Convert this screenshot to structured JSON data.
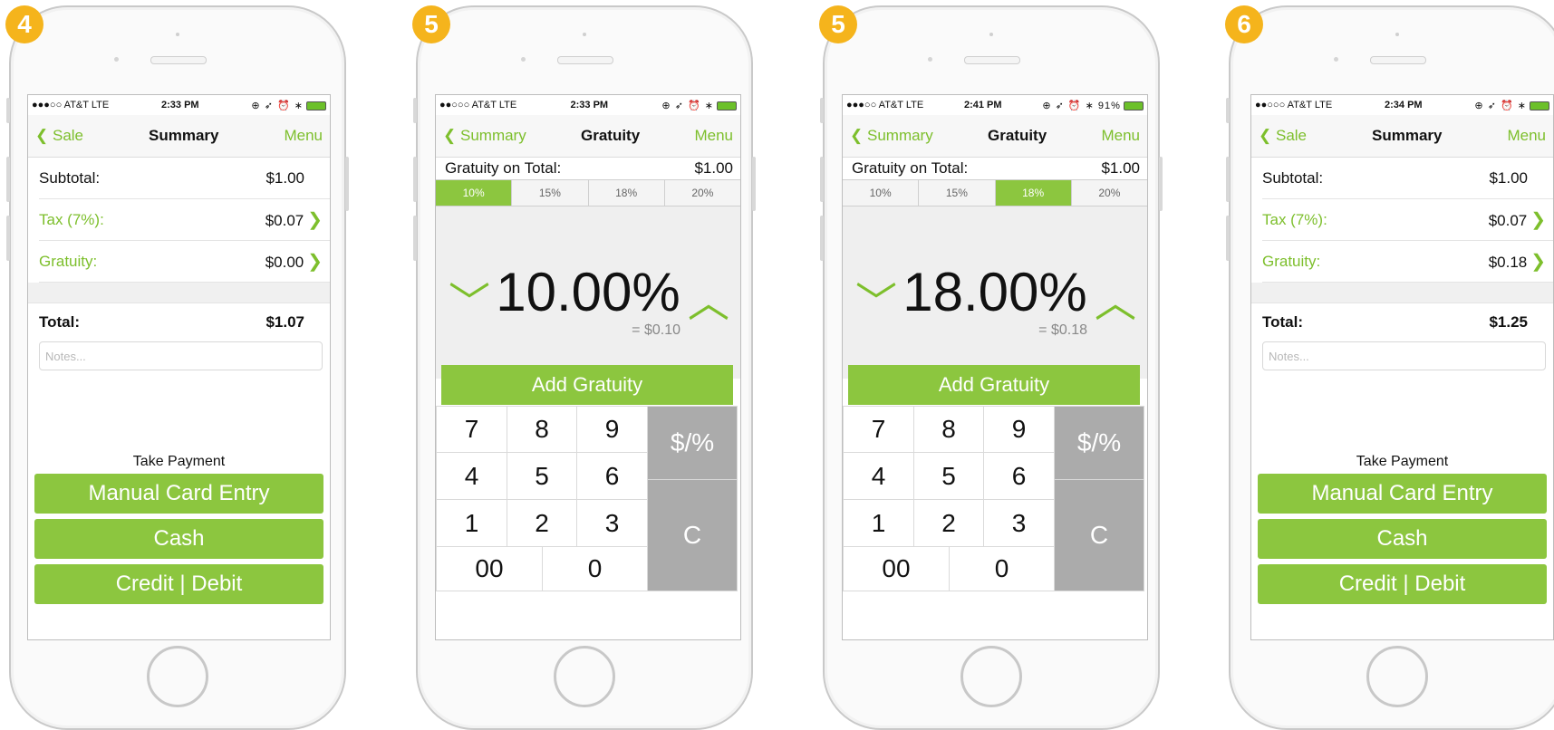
{
  "phones": [
    {
      "badge": "4",
      "status": {
        "carrier": "●●●○○ AT&T  LTE",
        "time": "2:33 PM",
        "icons": "⊕ ➶ ⏰ ∗"
      },
      "nav": {
        "back": "Sale",
        "title": "Summary",
        "menu": "Menu"
      },
      "summary": {
        "subtotal_label": "Subtotal:",
        "subtotal": "$1.00",
        "tax_label": "Tax (7%):",
        "tax": "$0.07",
        "gratuity_label": "Gratuity:",
        "gratuity": "$0.00",
        "total_label": "Total:",
        "total": "$1.07",
        "notes_placeholder": "Notes..."
      },
      "take_payment": "Take Payment",
      "buttons": [
        "Manual Card Entry",
        "Cash",
        "Credit | Debit"
      ]
    },
    {
      "badge": "5",
      "status": {
        "carrier": "●●○○○ AT&T  LTE",
        "time": "2:33 PM",
        "icons": "⊕ ➶ ⏰ ∗"
      },
      "nav": {
        "back": "Summary",
        "title": "Gratuity",
        "menu": "Menu"
      },
      "gratuity": {
        "label": "Gratuity on Total:",
        "amount": "$1.00",
        "options": [
          "10%",
          "15%",
          "18%",
          "20%"
        ],
        "selected": 0,
        "percent": "10.00%",
        "equals": "= $0.10",
        "add_label": "Add Gratuity"
      },
      "keys": [
        "7",
        "8",
        "9",
        "4",
        "5",
        "6",
        "1",
        "2",
        "3",
        "00",
        "0",
        "$/%",
        "C"
      ]
    },
    {
      "badge": "5",
      "status": {
        "carrier": "●●●○○ AT&T  LTE",
        "time": "2:41 PM",
        "icons": "⊕ ➶ ⏰ ∗ 91%"
      },
      "nav": {
        "back": "Summary",
        "title": "Gratuity",
        "menu": "Menu"
      },
      "gratuity": {
        "label": "Gratuity on Total:",
        "amount": "$1.00",
        "options": [
          "10%",
          "15%",
          "18%",
          "20%"
        ],
        "selected": 2,
        "percent": "18.00%",
        "equals": "= $0.18",
        "add_label": "Add Gratuity"
      },
      "keys": [
        "7",
        "8",
        "9",
        "4",
        "5",
        "6",
        "1",
        "2",
        "3",
        "00",
        "0",
        "$/%",
        "C"
      ]
    },
    {
      "badge": "6",
      "status": {
        "carrier": "●●○○○ AT&T  LTE",
        "time": "2:34 PM",
        "icons": "⊕ ➶ ⏰ ∗"
      },
      "nav": {
        "back": "Sale",
        "title": "Summary",
        "menu": "Menu"
      },
      "summary": {
        "subtotal_label": "Subtotal:",
        "subtotal": "$1.00",
        "tax_label": "Tax (7%):",
        "tax": "$0.07",
        "gratuity_label": "Gratuity:",
        "gratuity": "$0.18",
        "total_label": "Total:",
        "total": "$1.25",
        "notes_placeholder": "Notes..."
      },
      "take_payment": "Take Payment",
      "buttons": [
        "Manual Card Entry",
        "Cash",
        "Credit | Debit"
      ]
    }
  ],
  "colors": {
    "accent": "#8cc63f",
    "badge": "#f5b41c",
    "key_gray": "#ababab"
  }
}
